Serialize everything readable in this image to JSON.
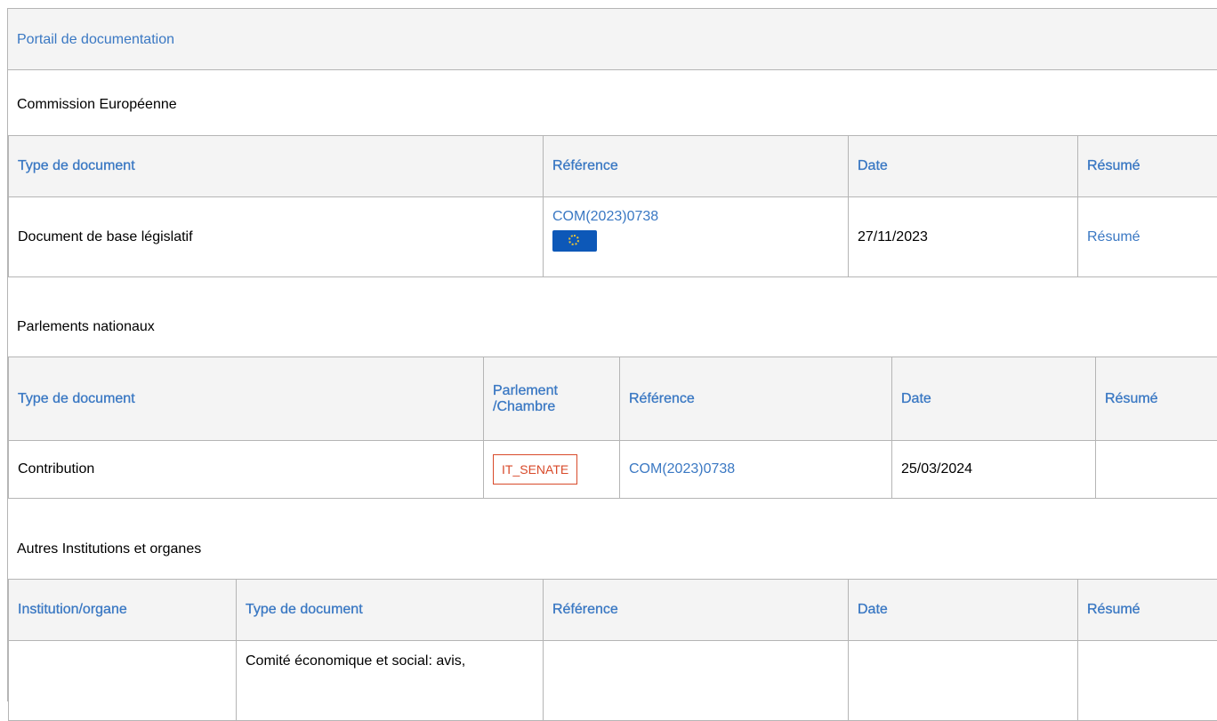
{
  "portal": {
    "title": "Portail de documentation"
  },
  "commission": {
    "title": "Commission Européenne",
    "headers": {
      "type": "Type de document",
      "reference": "Référence",
      "date": "Date",
      "resume": "Résumé"
    },
    "row": {
      "type": "Document de base législatif",
      "reference": "COM(2023)0738",
      "flag_icon": "eu-flag-icon",
      "date": "27/11/2023",
      "resume": "Résumé"
    }
  },
  "parlements": {
    "title": "Parlements nationaux",
    "headers": {
      "type": "Type de document",
      "parlement_line1": "Parlement",
      "parlement_line2": "/Chambre",
      "reference": "Référence",
      "date": "Date",
      "resume": "Résumé"
    },
    "row": {
      "type": "Contribution",
      "parlement": "IT_SENATE",
      "reference": "COM(2023)0738",
      "date": "25/03/2024",
      "resume": ""
    }
  },
  "autres": {
    "title": "Autres Institutions et organes",
    "headers": {
      "institution": "Institution/organe",
      "type": "Type de document",
      "reference": "Référence",
      "date": "Date",
      "resume": "Résumé"
    },
    "row": {
      "institution": "",
      "type": "Comité économique et social: avis,",
      "reference": "",
      "date": "",
      "resume": ""
    }
  },
  "colors": {
    "link": "#3a78c3",
    "badge": "#d84a2a",
    "header_bg": "#f4f4f4",
    "border": "#b5b5b5",
    "flag": "#0d58b8"
  }
}
